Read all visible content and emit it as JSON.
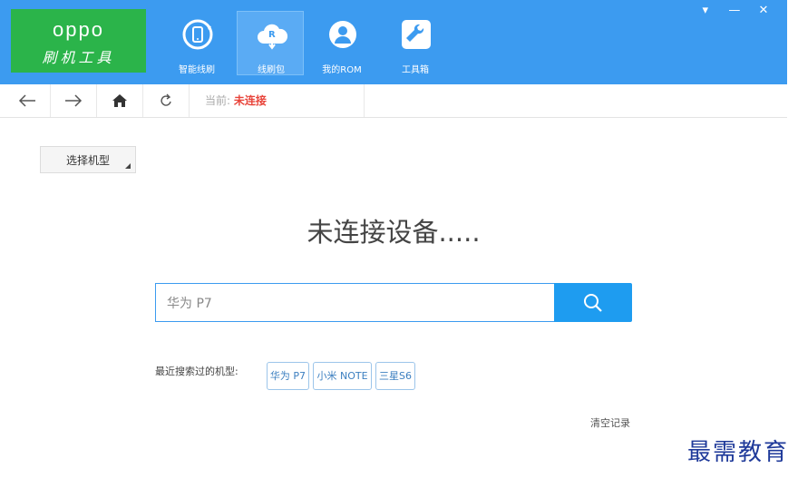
{
  "app": {
    "brand": "oppo",
    "subtitle": "刷机工具"
  },
  "nav": {
    "items": [
      {
        "label": "智能线刷",
        "icon": "phone-refresh-icon"
      },
      {
        "label": "线刷包",
        "icon": "cloud-download-icon"
      },
      {
        "label": "我的ROM",
        "icon": "user-circle-icon"
      },
      {
        "label": "工具箱",
        "icon": "wrench-icon"
      }
    ],
    "active_index": 1
  },
  "window_controls": {
    "menu": "▾",
    "minimize": "—",
    "close": "✕"
  },
  "toolbar": {
    "status_label": "当前: ",
    "status_value": "未连接"
  },
  "model_select": {
    "label": "选择机型"
  },
  "main": {
    "message": "未连接设备....."
  },
  "search": {
    "value": "华为 P7"
  },
  "recent": {
    "label": "最近搜索过的机型:",
    "items": [
      "华为 P7",
      "小米 NOTE",
      "三星S6"
    ]
  },
  "clear_label": "清空记录",
  "watermark": "最需教育",
  "colors": {
    "header_bg": "#3c9bf0",
    "logo_bg": "#2bb44a",
    "status_red": "#e8443a",
    "search_btn": "#1e9cf0"
  }
}
